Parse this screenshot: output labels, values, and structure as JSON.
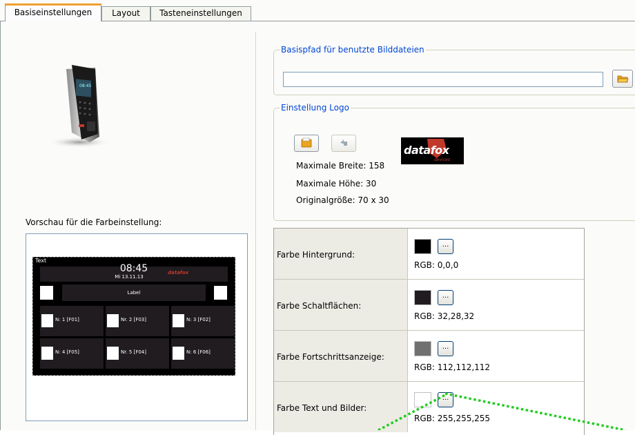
{
  "tabs": [
    {
      "label": "Basiseinstellungen",
      "active": true
    },
    {
      "label": "Layout",
      "active": false
    },
    {
      "label": "Tasteneinstellungen",
      "active": false
    }
  ],
  "preview": {
    "label": "Vorschau für die Farbeinstellung:",
    "screen": {
      "text_corner": "Text",
      "time": "08:45",
      "date": "Mi 13.11.13",
      "logo": "datafox",
      "label_bar": "Label",
      "buttons": [
        "N: 1 [F01]",
        "Nr. 2 [F03]",
        "N: 3 [F02]",
        "N: 4 [F05]",
        "Nr. 5 [F04]",
        "N: 6 [F06]"
      ]
    }
  },
  "basepath": {
    "title": "Basispfad für benutzte Bilddateien",
    "value": "",
    "browse_icon": "folder-icon"
  },
  "logo": {
    "title": "Einstellung Logo",
    "load_icon": "folder-open-icon",
    "reset_icon": "undo-arrow-icon",
    "logo_text": "datafox",
    "logo_subtext": "devices",
    "max_width": "Maximale Breite: 158",
    "max_height": "Maximale Höhe: 30",
    "original_size": "Originalgröße: 70 x 30"
  },
  "colors": {
    "rows": [
      {
        "label": "Farbe Hintergrund:",
        "swatch": "#000000",
        "button": "...",
        "rgb": "RGB: 0,0,0"
      },
      {
        "label": "Farbe Schaltflächen:",
        "swatch": "#201c20",
        "button": "...",
        "rgb": "RGB: 32,28,32"
      },
      {
        "label": "Farbe Fortschrittsanzeige:",
        "swatch": "#707070",
        "button": "...",
        "rgb": "RGB: 112,112,112"
      },
      {
        "label": "Farbe Text und Bilder:",
        "swatch": "#ffffff",
        "button": "...",
        "rgb": "RGB: 255,255,255"
      }
    ]
  },
  "theme": {
    "accent_tab": "#f0a030",
    "group_title": "#0046d5",
    "annotation": "#22cc22"
  }
}
